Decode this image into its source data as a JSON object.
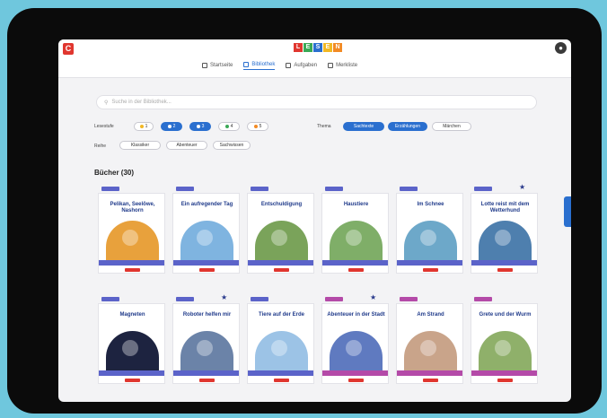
{
  "app": {
    "logo_letter": "C",
    "brand_letters": [
      "L",
      "E",
      "S",
      "E",
      "N"
    ]
  },
  "nav": [
    {
      "label": "Startseite",
      "active": false
    },
    {
      "label": "Bibliothek",
      "active": true
    },
    {
      "label": "Aufgaben",
      "active": false
    },
    {
      "label": "Merkliste",
      "active": false
    }
  ],
  "search": {
    "placeholder": "Suche in der Bibliothek..."
  },
  "filters": {
    "level_label": "Lesestufe",
    "levels": [
      {
        "label": "1",
        "color": "#f2b824",
        "selected": false
      },
      {
        "label": "2",
        "color": "#2a6fcf",
        "selected": true
      },
      {
        "label": "3",
        "color": "#2a6fcf",
        "selected": true
      },
      {
        "label": "4",
        "color": "#3aa856",
        "selected": false
      },
      {
        "label": "5",
        "color": "#f28a24",
        "selected": false
      }
    ],
    "type_label": "Thema",
    "types": [
      {
        "label": "Sachtexte",
        "selected": true
      },
      {
        "label": "Erzählungen",
        "selected": true
      },
      {
        "label": "Märchen",
        "selected": false
      }
    ],
    "series_label": "Reihe",
    "series": [
      "Klassiker",
      "Abenteuer",
      "Sachwissen"
    ]
  },
  "section": {
    "title": "Bücher (30)"
  },
  "books": [
    {
      "title": "Pelikan, Seelöwe, Nashorn",
      "tag_color": "#5b63c9",
      "favorite": false,
      "art_color": "#e8a13c"
    },
    {
      "title": "Ein aufregender Tag",
      "tag_color": "#5b63c9",
      "favorite": false,
      "art_color": "#7fb4e0"
    },
    {
      "title": "Entschuldigung",
      "tag_color": "#5b63c9",
      "favorite": false,
      "art_color": "#7aa35a"
    },
    {
      "title": "Haustiere",
      "tag_color": "#5b63c9",
      "favorite": false,
      "art_color": "#7fae68"
    },
    {
      "title": "Im Schnee",
      "tag_color": "#5b63c9",
      "favorite": false,
      "art_color": "#6da8c9"
    },
    {
      "title": "Lotte reist mit dem Wetterhund",
      "tag_color": "#5b63c9",
      "favorite": true,
      "art_color": "#4e7fae"
    },
    {
      "title": "Magneten",
      "tag_color": "#5b63c9",
      "favorite": false,
      "art_color": "#1d2340"
    },
    {
      "title": "Roboter helfen mir",
      "tag_color": "#5b63c9",
      "favorite": true,
      "art_color": "#6b83a8"
    },
    {
      "title": "Tiere auf der Erde",
      "tag_color": "#5b63c9",
      "favorite": false,
      "art_color": "#9cc3e6"
    },
    {
      "title": "Abenteuer in der Stadt",
      "tag_color": "#b44aa8",
      "favorite": true,
      "art_color": "#5f7ac0"
    },
    {
      "title": "Am Strand",
      "tag_color": "#b44aa8",
      "favorite": false,
      "art_color": "#c9a48a"
    },
    {
      "title": "Grete und der Wurm",
      "tag_color": "#b44aa8",
      "favorite": false,
      "art_color": "#8fb06a"
    }
  ]
}
